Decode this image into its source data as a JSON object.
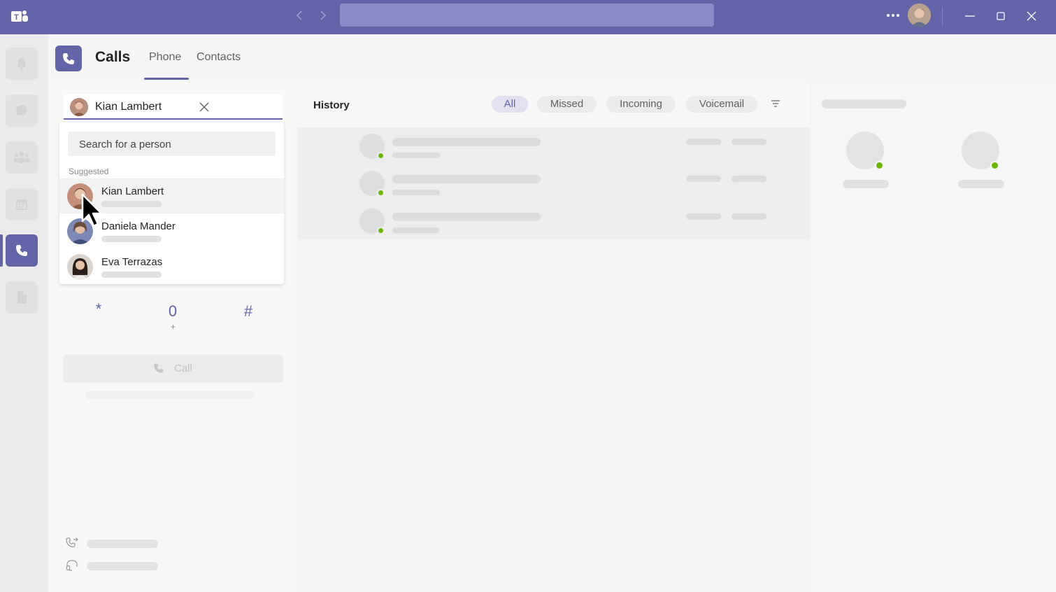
{
  "window": {
    "search_placeholder": "",
    "icons": [
      "teams-logo-icon",
      "back-icon",
      "forward-icon",
      "more-icon",
      "minimize-icon",
      "maximize-icon",
      "close-icon"
    ]
  },
  "app": {
    "title": "Calls",
    "tabs": [
      {
        "label": "Phone",
        "active": true
      },
      {
        "label": "Contacts",
        "active": false
      }
    ],
    "accent_color": "#6264a7"
  },
  "rail": {
    "items": [
      "activity-icon",
      "chat-icon",
      "teams-icon",
      "calendar-icon",
      "calls-icon",
      "files-icon"
    ],
    "active_index": 4
  },
  "dialer": {
    "recipient": {
      "name": "Kian Lambert"
    },
    "search_placeholder": "Search for a person",
    "suggested_label": "Suggested",
    "suggestions": [
      {
        "name": "Kian Lambert"
      },
      {
        "name": "Daniela Mander"
      },
      {
        "name": "Eva Terrazas"
      }
    ],
    "keys": [
      {
        "main": "*",
        "sub": ""
      },
      {
        "main": "0",
        "sub": "+"
      },
      {
        "main": "#",
        "sub": ""
      }
    ],
    "call_label": "Call"
  },
  "history": {
    "title": "History",
    "filters": [
      {
        "label": "All",
        "active": true
      },
      {
        "label": "Missed",
        "active": false
      },
      {
        "label": "Incoming",
        "active": false
      },
      {
        "label": "Voicemail",
        "active": false
      }
    ],
    "status_color": "#6bb700"
  }
}
